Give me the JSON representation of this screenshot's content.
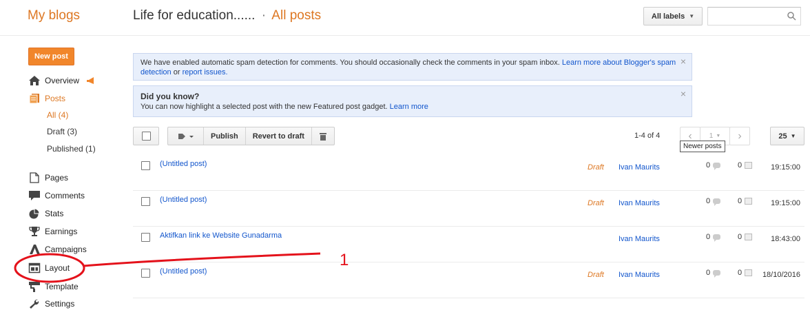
{
  "header": {
    "brand": "My blogs",
    "blog_title": "Life for education......",
    "separator": "·",
    "section": "All posts",
    "labels_button": "All labels",
    "search_placeholder": ""
  },
  "sidebar": {
    "new_post": "New post",
    "items": [
      {
        "label": "Overview",
        "icon": "home-icon"
      },
      {
        "label": "Posts",
        "icon": "posts-icon"
      },
      {
        "label": "Pages",
        "icon": "pages-icon"
      },
      {
        "label": "Comments",
        "icon": "comments-icon"
      },
      {
        "label": "Stats",
        "icon": "stats-icon"
      },
      {
        "label": "Earnings",
        "icon": "trophy-icon"
      },
      {
        "label": "Campaigns",
        "icon": "campaigns-icon"
      },
      {
        "label": "Layout",
        "icon": "layout-icon"
      },
      {
        "label": "Template",
        "icon": "template-icon"
      },
      {
        "label": "Settings",
        "icon": "wrench-icon"
      }
    ],
    "post_sub": [
      {
        "label": "All (4)"
      },
      {
        "label": "Draft (3)"
      },
      {
        "label": "Published (1)"
      }
    ]
  },
  "notices": {
    "spam_text": "We have enabled automatic spam detection for comments. You should occasionally check the comments in your spam inbox.",
    "spam_link1": "Learn more about Blogger's spam detection",
    "spam_or": "or",
    "spam_link2": "report issues.",
    "tip_title": "Did you know?",
    "tip_text": "You can now highlight a selected post with the new Featured post gadget.",
    "tip_link": "Learn more",
    "close": "×"
  },
  "toolbar": {
    "publish": "Publish",
    "revert": "Revert to draft",
    "range": "1-4 of 4",
    "prev": "‹",
    "page": "1",
    "next": "›",
    "per_page": "25",
    "tooltip": "Newer posts"
  },
  "posts": [
    {
      "title": "(Untitled post)",
      "status": "Draft",
      "author": "Ivan Maurits",
      "comments": "0",
      "views": "0",
      "time": "19:15:00"
    },
    {
      "title": "(Untitled post)",
      "status": "Draft",
      "author": "Ivan Maurits",
      "comments": "0",
      "views": "0",
      "time": "19:15:00"
    },
    {
      "title": "Aktifkan link ke Website Gunadarma",
      "status": "",
      "author": "Ivan Maurits",
      "comments": "0",
      "views": "0",
      "time": "18:43:00"
    },
    {
      "title": "(Untitled post)",
      "status": "Draft",
      "author": "Ivan Maurits",
      "comments": "0",
      "views": "0",
      "time": "18/10/2016"
    }
  ],
  "annotation": {
    "number": "1"
  },
  "colors": {
    "accent": "#dd7722",
    "link": "#1155cc",
    "annotation": "#e4121b"
  }
}
